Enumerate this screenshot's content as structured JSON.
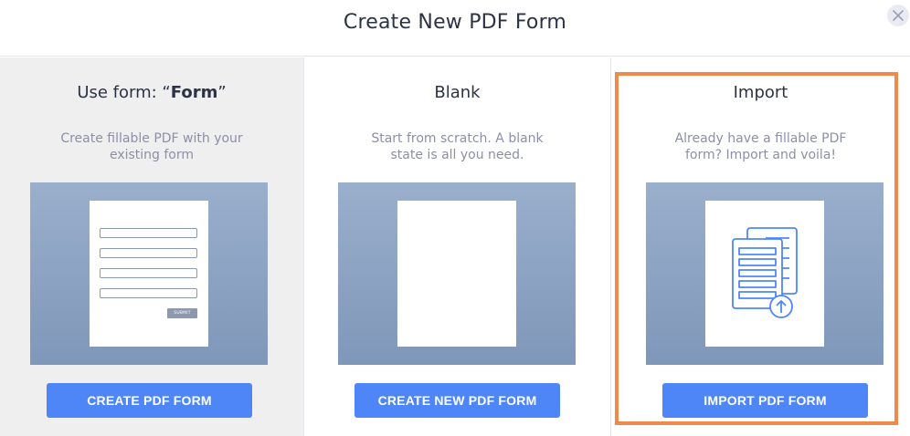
{
  "header": {
    "title": "Create New PDF Form",
    "close_icon": "close-icon"
  },
  "options": [
    {
      "title_prefix": "Use form: “",
      "title_bold": "Form",
      "title_suffix": "”",
      "description": "Create fillable PDF with your existing form",
      "preview": {
        "submit_label": "SUBMIT"
      },
      "button_label": "CREATE PDF FORM"
    },
    {
      "title": "Blank",
      "description": "Start from scratch. A blank state is all you need.",
      "button_label": "CREATE NEW PDF FORM"
    },
    {
      "title": "Import",
      "description": "Already have a fillable PDF form? Import and voila!",
      "preview": {
        "icon": "pdf-import-icon"
      },
      "button_label": "IMPORT PDF FORM",
      "selected": true
    }
  ],
  "colors": {
    "button": "#4f86f7",
    "selected_border": "#f08a4b",
    "preview_bg": "#8fa6c6",
    "icon": "#4f86f7"
  }
}
